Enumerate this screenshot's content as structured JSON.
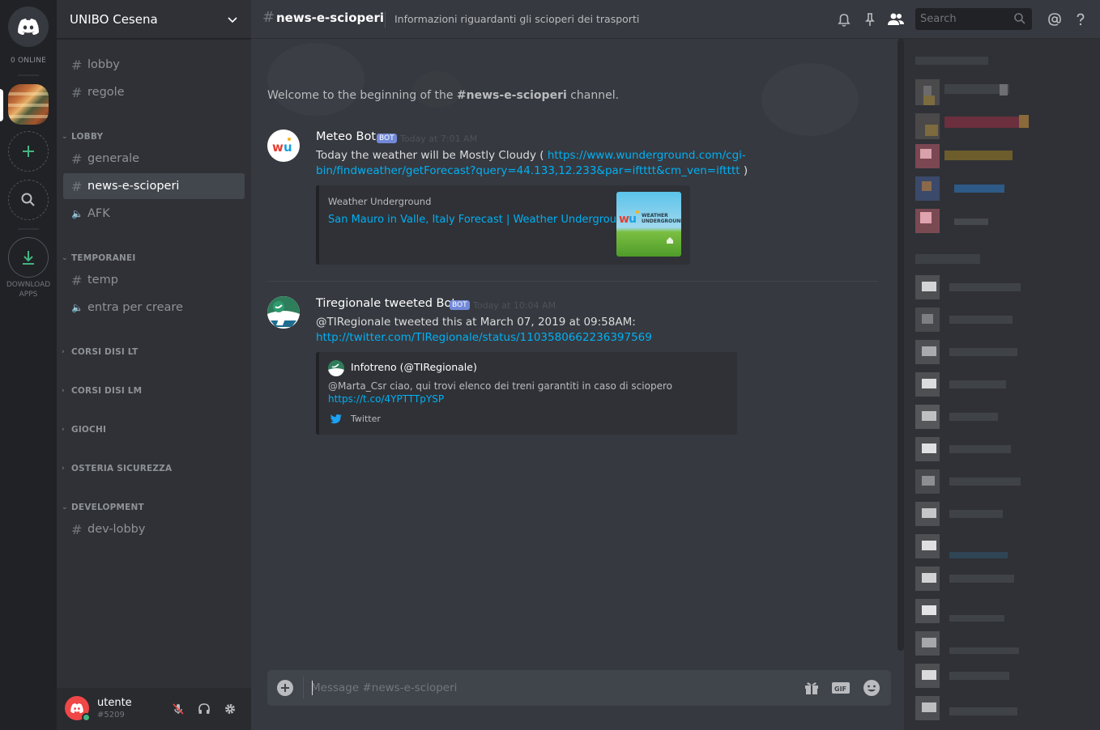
{
  "rail": {
    "online_label": "0 ONLINE",
    "download_label_1": "DOWNLOAD",
    "download_label_2": "APPS"
  },
  "sidebar": {
    "server_name": "UNIBO Cesena",
    "channels_top": [
      {
        "name": "lobby"
      },
      {
        "name": "regole"
      }
    ],
    "categories": {
      "lobby": {
        "label": "LOBBY",
        "channels": [
          "generale",
          "news-e-scioperi",
          "AFK"
        ]
      },
      "temporanei": {
        "label": "TEMPORANEI",
        "channels": [
          "temp",
          "entra per creare"
        ]
      },
      "corsi_lt": {
        "label": "CORSI DISI LT"
      },
      "corsi_lm": {
        "label": "CORSI DISI LM"
      },
      "giochi": {
        "label": "GIOCHI"
      },
      "osteria": {
        "label": "OSTERIA SICUREZZA"
      },
      "development": {
        "label": "DEVELOPMENT",
        "channels": [
          "dev-lobby"
        ]
      }
    }
  },
  "user": {
    "name": "utente",
    "tag": "#5209"
  },
  "header": {
    "hash": "#",
    "channel_name": "news-e-scioperi",
    "topic": "Informazioni riguardanti gli scioperi dei trasporti",
    "search_placeholder": "Search"
  },
  "chat": {
    "welcome_prefix": "Welcome to the beginning of the ",
    "welcome_channel": "#news-e-scioperi",
    "welcome_suffix": " channel.",
    "messages": [
      {
        "author": "Meteo Bot",
        "bot_tag": "BOT",
        "timestamp": "Today at 7:01 AM",
        "text_prefix": "Today the weather will be Mostly Cloudy ( ",
        "link_line1": "https://www.wunderground.com/cgi-",
        "link_line2": "bin/findweather/getForecast?query=44.133,12.233&par=iftttt&cm_ven=iftttt",
        "text_suffix": " )",
        "embed_provider": "Weather Underground",
        "embed_title": "San Mauro in Valle, Italy Forecast | Weather Underground",
        "thumb_logo": "WEATHER UNDERGROUND"
      },
      {
        "author": "Tiregionale tweeted Bot",
        "bot_tag": "BOT",
        "timestamp": "Today at 10:04 AM",
        "text": "@TIRegionale tweeted this at March 07, 2019 at 09:58AM:",
        "link": "http://twitter.com/TIRegionale/status/1103580662236397569",
        "embed_author": "Infotreno (@TIRegionale)",
        "embed_desc": "@Marta_Csr ciao, qui trovi elenco dei treni garantiti in caso di sciopero",
        "embed_link": "https://t.co/4YPTTTpYSP",
        "embed_footer": "Twitter"
      }
    ]
  },
  "composer": {
    "placeholder": "Message #news-e-scioperi"
  },
  "icons": {
    "home": "discord-logo-icon",
    "add_server": "plus-icon",
    "explore": "search-icon",
    "download": "download-icon",
    "bell": "bell-icon",
    "pin": "pin-icon",
    "members": "members-icon",
    "mention": "at-icon",
    "help": "help-icon"
  },
  "colors": {
    "accent": "#7289da",
    "link": "#00b0f4",
    "online": "#43b581",
    "danger": "#f04747"
  }
}
